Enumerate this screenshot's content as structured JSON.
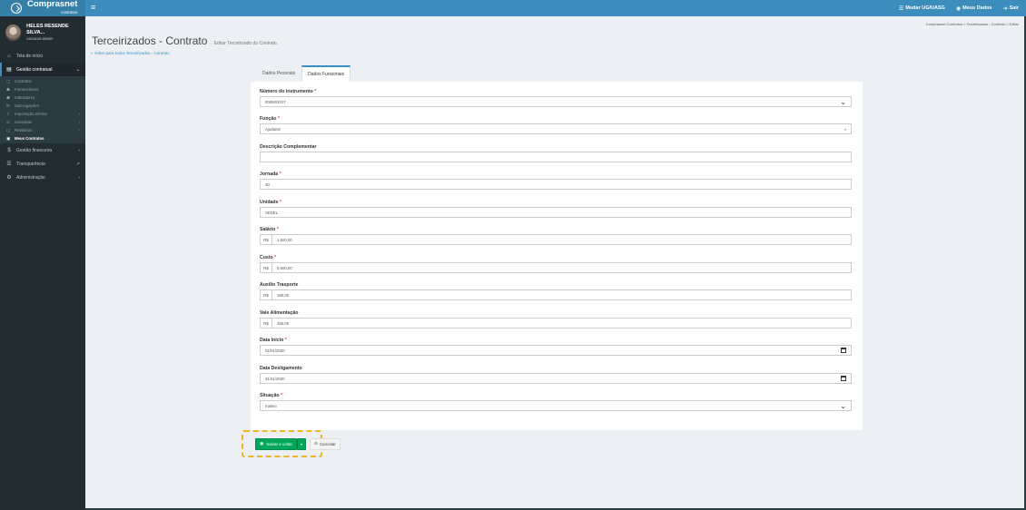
{
  "brand": {
    "name": "Comprasnet",
    "sub": "contratos"
  },
  "topbar": {
    "menu_icon": "hamburger-icon",
    "unit": "Mudar UG/UASG",
    "my_data": "Meus Dados",
    "logout": "Sair"
  },
  "user": {
    "name": "HELES RESENDE SILVA...",
    "sub": "UG/UASG 000000"
  },
  "sidebar": {
    "home": "Tela de início",
    "contract_mgmt": "Gestão contratual",
    "sub_items": [
      {
        "label": "Contratos",
        "has_children": false
      },
      {
        "label": "Fornecedores",
        "has_children": false
      },
      {
        "label": "Indicadores",
        "has_children": false
      },
      {
        "label": "Sub-rogações",
        "has_children": false
      },
      {
        "label": "Importação SIASG",
        "has_children": true
      },
      {
        "label": "Consultas",
        "has_children": true
      },
      {
        "label": "Relatórios",
        "has_children": true
      },
      {
        "label": "Meus Contratos",
        "has_children": false
      }
    ],
    "financial": "Gestão financeira",
    "transparency": "Transparência",
    "admin": "Administração"
  },
  "header": {
    "title": "Terceirizados - Contrato",
    "subtitle": "Editar Terceirizado do Contrato.",
    "back_link": "« Voltar para todos Terceirizados - Contrato"
  },
  "breadcrumb": "Comprasnet Contratos  >  Terceirizados - Contrato  >  Editar",
  "tabs": [
    {
      "label": "Dados Pessoais",
      "active": false
    },
    {
      "label": "Dados Funcionais",
      "active": true
    }
  ],
  "form": {
    "instrument": {
      "label": "Número do instrumento",
      "value": "00050/2017"
    },
    "function": {
      "label": "Função",
      "value": "Ajudante"
    },
    "description": {
      "label": "Descrição Complementar",
      "value": ""
    },
    "hours": {
      "label": "Jornada",
      "value": "40"
    },
    "unit": {
      "label": "Unidade",
      "value": "SEDEL"
    },
    "salary": {
      "label": "Salário",
      "prefix": "R$",
      "value": "1.500,00"
    },
    "cost": {
      "label": "Custo",
      "prefix": "R$",
      "value": "5.500,00"
    },
    "transport": {
      "label": "Auxílio Trasporte",
      "prefix": "R$",
      "value": "180,00"
    },
    "meal": {
      "label": "Vale Alimentação",
      "prefix": "R$",
      "value": "255,00"
    },
    "start_date": {
      "label": "Data Início",
      "value": "01/01/2020"
    },
    "end_date": {
      "label": "Data Desligamento",
      "value": "31/01/2020"
    },
    "status": {
      "label": "Situação",
      "value": "Inativo"
    }
  },
  "actions": {
    "save": "Salvar e voltar",
    "cancel": "Cancelar"
  },
  "colors": {
    "primary": "#3c8dbc",
    "sidebar": "#222d32",
    "success": "#00a65a",
    "highlight": "#f0b322"
  }
}
